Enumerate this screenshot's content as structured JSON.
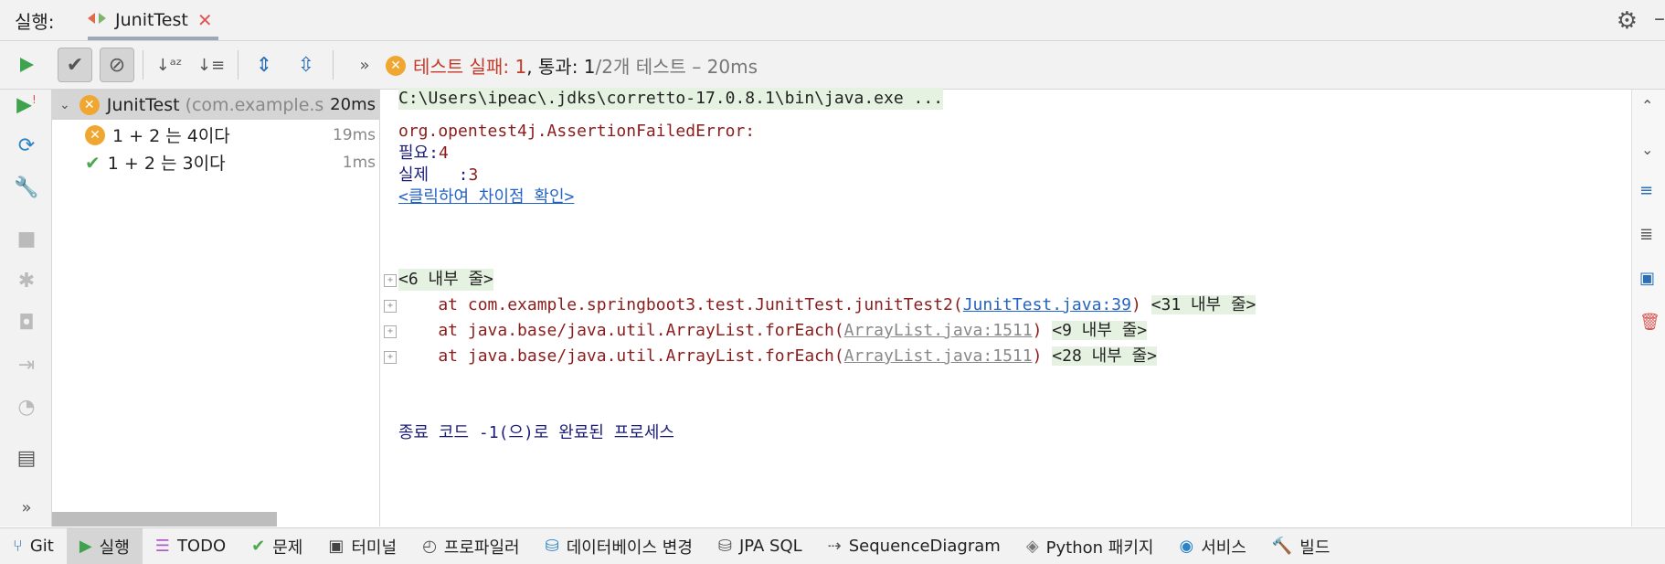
{
  "header": {
    "run_label": "실행:",
    "tab_title": "JunitTest"
  },
  "status": {
    "prefix": "테스트 실패: 1",
    "passed": ", 통과: 1",
    "rest": " /2개 테스트 – 20ms"
  },
  "tree": {
    "root": {
      "name": "JunitTest",
      "pkg": "(com.example.s",
      "time": "20ms"
    },
    "items": [
      {
        "label": "1 + 2 는 4이다",
        "time": "19ms",
        "status": "fail"
      },
      {
        "label": "1 + 2 는 3이다",
        "time": "1ms",
        "status": "pass"
      }
    ]
  },
  "console": {
    "cmd": "C:\\Users\\ipeac\\.jdks\\corretto-17.0.8.1\\bin\\java.exe ...",
    "error": "org.opentest4j.AssertionFailedError:",
    "expected_label": "필요:",
    "expected_value": "4",
    "actual_label": "실제   :",
    "actual_value": "3",
    "diff_link": "<클릭하여 차이점 확인>",
    "internal6": "<6 내부 줄>",
    "trace1_pre": "    at com.example.springboot3.test.JunitTest.junitTest2(",
    "trace1_link": "JunitTest.java:39",
    "trace1_post": ")",
    "trace1_fold": "<31 내부 줄>",
    "trace2_pre": "    at java.base/java.util.ArrayList.forEach(",
    "trace2_link": "ArrayList.java:1511",
    "trace2_post": ")",
    "trace2_fold": "<9 내부 줄>",
    "trace3_pre": "    at java.base/java.util.ArrayList.forEach(",
    "trace3_link": "ArrayList.java:1511",
    "trace3_post": ")",
    "trace3_fold": "<28 내부 줄>",
    "exit": "종료 코드 -1(으)로 완료된 프로세스"
  },
  "bottom_tabs": [
    {
      "label": "Git",
      "icon": "git-icon"
    },
    {
      "label": "실행",
      "icon": "run-icon"
    },
    {
      "label": "TODO",
      "icon": "todo-icon"
    },
    {
      "label": "문제",
      "icon": "problems-icon"
    },
    {
      "label": "터미널",
      "icon": "terminal-icon"
    },
    {
      "label": "프로파일러",
      "icon": "profiler-icon"
    },
    {
      "label": "데이터베이스 변경",
      "icon": "database-icon"
    },
    {
      "label": "JPA SQL",
      "icon": "jpa-icon"
    },
    {
      "label": "SequenceDiagram",
      "icon": "sequence-icon"
    },
    {
      "label": "Python 패키지",
      "icon": "python-packages-icon"
    },
    {
      "label": "서비스",
      "icon": "services-icon"
    },
    {
      "label": "빌드",
      "icon": "build-icon"
    }
  ],
  "colors": {
    "fail": "#c23b2a",
    "pass": "#4fa84f",
    "link": "#2463c6",
    "warn_badge": "#f0a732"
  }
}
